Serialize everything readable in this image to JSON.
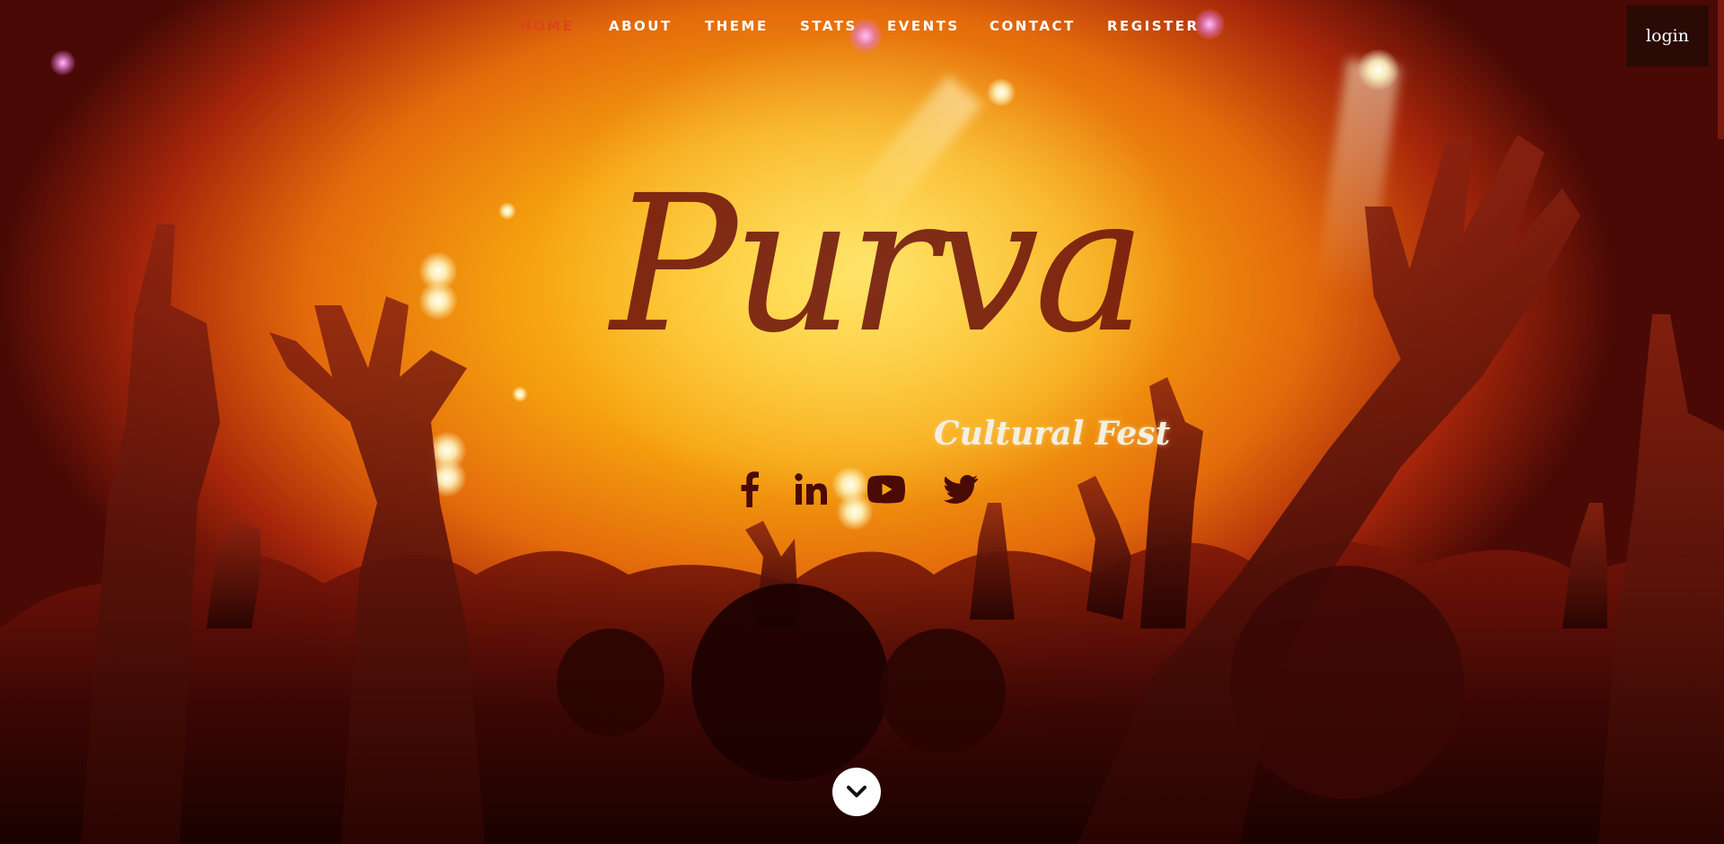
{
  "nav": {
    "items": [
      {
        "label": "HOME",
        "active": true
      },
      {
        "label": "ABOUT"
      },
      {
        "label": "THEME"
      },
      {
        "label": "STATS"
      },
      {
        "label": "EVENTS"
      },
      {
        "label": "CONTACT"
      },
      {
        "label": "REGISTER"
      }
    ],
    "login_label": "login"
  },
  "hero": {
    "title": "Purva",
    "subtitle": "Cultural Fest"
  },
  "social": {
    "icons": [
      "facebook-icon",
      "linkedin-icon",
      "youtube-icon",
      "twitter-icon"
    ]
  },
  "colors": {
    "active_nav": "#d9471a",
    "title": "#6b0f0c",
    "login_bg": "#2a0a04",
    "background_glow": "#ffc21a"
  },
  "scroll_down_icon": "chevron-down-icon"
}
